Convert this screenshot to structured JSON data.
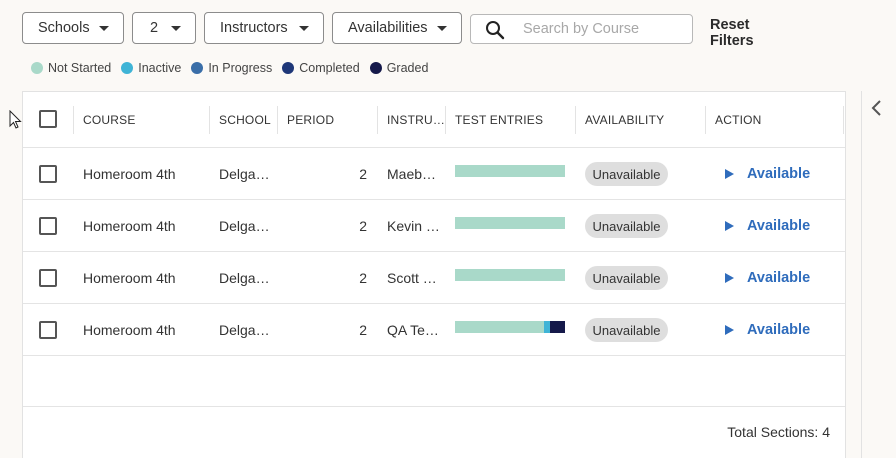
{
  "filters": {
    "schools": "Schools",
    "period": "2",
    "instructors": "Instructors",
    "availabilities": "Availabilities",
    "search_placeholder": "Search by Course",
    "reset_label": "Reset Filters"
  },
  "legend": [
    {
      "label": "Not Started",
      "color": "#a9d9c9"
    },
    {
      "label": "Inactive",
      "color": "#3fb4d6"
    },
    {
      "label": "In Progress",
      "color": "#3a6ea8"
    },
    {
      "label": "Completed",
      "color": "#1e3778"
    },
    {
      "label": "Graded",
      "color": "#15194a"
    }
  ],
  "table": {
    "headers": {
      "course": "COURSE",
      "school": "SCHOOL",
      "period": "PERIOD",
      "instructor": "INSTRU…",
      "test_entries": "TEST ENTRIES",
      "availability": "AVAILABILITY",
      "action": "ACTION"
    },
    "rows": [
      {
        "course": "Homeroom 4th",
        "school": "Delga…",
        "period": "2",
        "instructor": "Maeb…",
        "availability": "Unavailable",
        "action": "Available",
        "entries": [
          {
            "status": "Not Started",
            "fraction": 1.0,
            "color": "#a9d9c9"
          }
        ]
      },
      {
        "course": "Homeroom 4th",
        "school": "Delga…",
        "period": "2",
        "instructor": "Kevin …",
        "availability": "Unavailable",
        "action": "Available",
        "entries": [
          {
            "status": "Not Started",
            "fraction": 1.0,
            "color": "#a9d9c9"
          }
        ]
      },
      {
        "course": "Homeroom 4th",
        "school": "Delga…",
        "period": "2",
        "instructor": "Scott …",
        "availability": "Unavailable",
        "action": "Available",
        "entries": [
          {
            "status": "Not Started",
            "fraction": 1.0,
            "color": "#a9d9c9"
          }
        ]
      },
      {
        "course": "Homeroom 4th",
        "school": "Delga…",
        "period": "2",
        "instructor": "QA Te…",
        "availability": "Unavailable",
        "action": "Available",
        "entries": [
          {
            "status": "Not Started",
            "fraction": 0.81,
            "color": "#a9d9c9"
          },
          {
            "status": "Inactive",
            "fraction": 0.05,
            "color": "#3fb4d6"
          },
          {
            "status": "Graded",
            "fraction": 0.14,
            "color": "#15194a"
          }
        ]
      }
    ],
    "total_label": "Total Sections: 4"
  }
}
